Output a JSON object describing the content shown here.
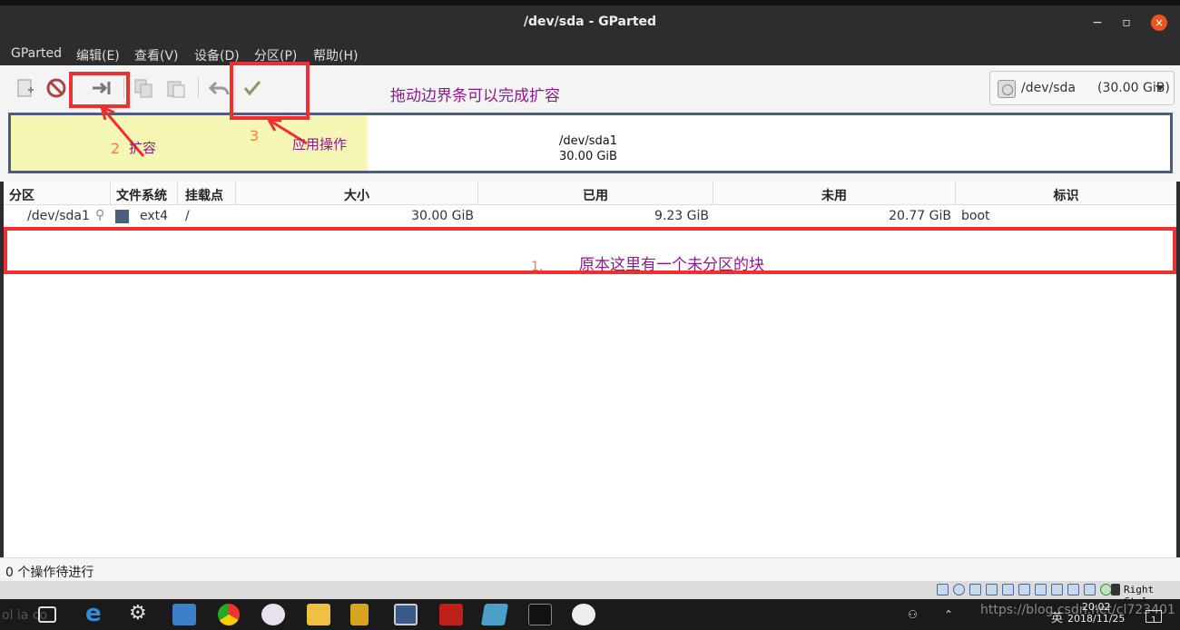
{
  "window": {
    "title": "/dev/sda - GParted",
    "min": "−",
    "max": "▫",
    "close": "×"
  },
  "menu": [
    "GParted",
    "编辑(E)",
    "查看(V)",
    "设备(D)",
    "分区(P)",
    "帮助(H)"
  ],
  "device_selector": {
    "device": "/dev/sda",
    "size": "(30.00 GiB)"
  },
  "disk_map": {
    "name": "/dev/sda1",
    "size": "30.00 GiB",
    "used_fraction": 0.308
  },
  "table": {
    "columns": [
      "分区",
      "文件系统",
      "挂载点",
      "大小",
      "已用",
      "未用",
      "标识"
    ],
    "rows": [
      {
        "partition": "/dev/sda1",
        "filesystem": "ext4",
        "mount": "/",
        "size": "30.00 GiB",
        "used": "9.23 GiB",
        "unused": "20.77 GiB",
        "flags": "boot",
        "color": "#4a6079"
      }
    ]
  },
  "status": "0 个操作待进行",
  "vbox_hostkey": "Right Ctrl",
  "taskbar": {
    "watermark": "ol ia co",
    "url_watermark": "https://blog.csdn.net/cl723401",
    "lang": "英",
    "time": "20:02",
    "date": "2018/11/25",
    "notif_count": "1"
  },
  "annotations": {
    "drag_tip": "拖动边界条可以完成扩容",
    "step2_num": "2",
    "step2_text": "扩容",
    "step3_num": "3",
    "step3_text": "应用操作",
    "step1_num": "1.",
    "step1_text": "原本这里有一个未分区的块"
  }
}
